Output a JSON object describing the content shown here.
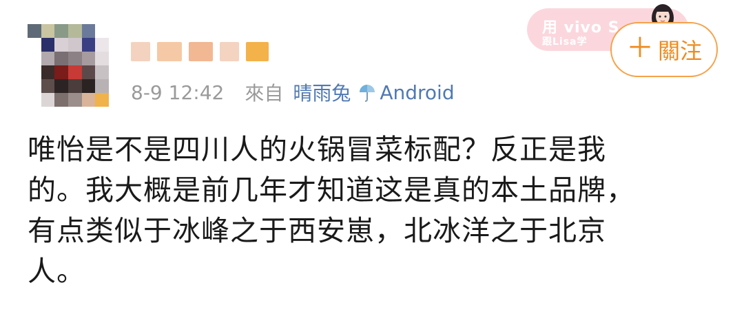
{
  "post": {
    "timestamp": "8-9 12:42",
    "source_prefix": "來自",
    "source_name": "晴雨兔",
    "device_name": "Android",
    "device_icon": "umbrella-icon",
    "follow_label": "關注",
    "follow_icon": "plus-icon",
    "banner_line1": "用 vivo S",
    "banner_line2": "跟Lisa学",
    "accent_color": "#f08a1c",
    "link_color": "#4f79b3",
    "body_lines": [
      "唯怡是不是四川人的火锅冒菜标配？反正是我",
      "的。我大概是前几年才知道这是真的本土品牌，",
      "有点类似于冰峰之于西安崽，北冰洋之于北京",
      "人。"
    ]
  }
}
